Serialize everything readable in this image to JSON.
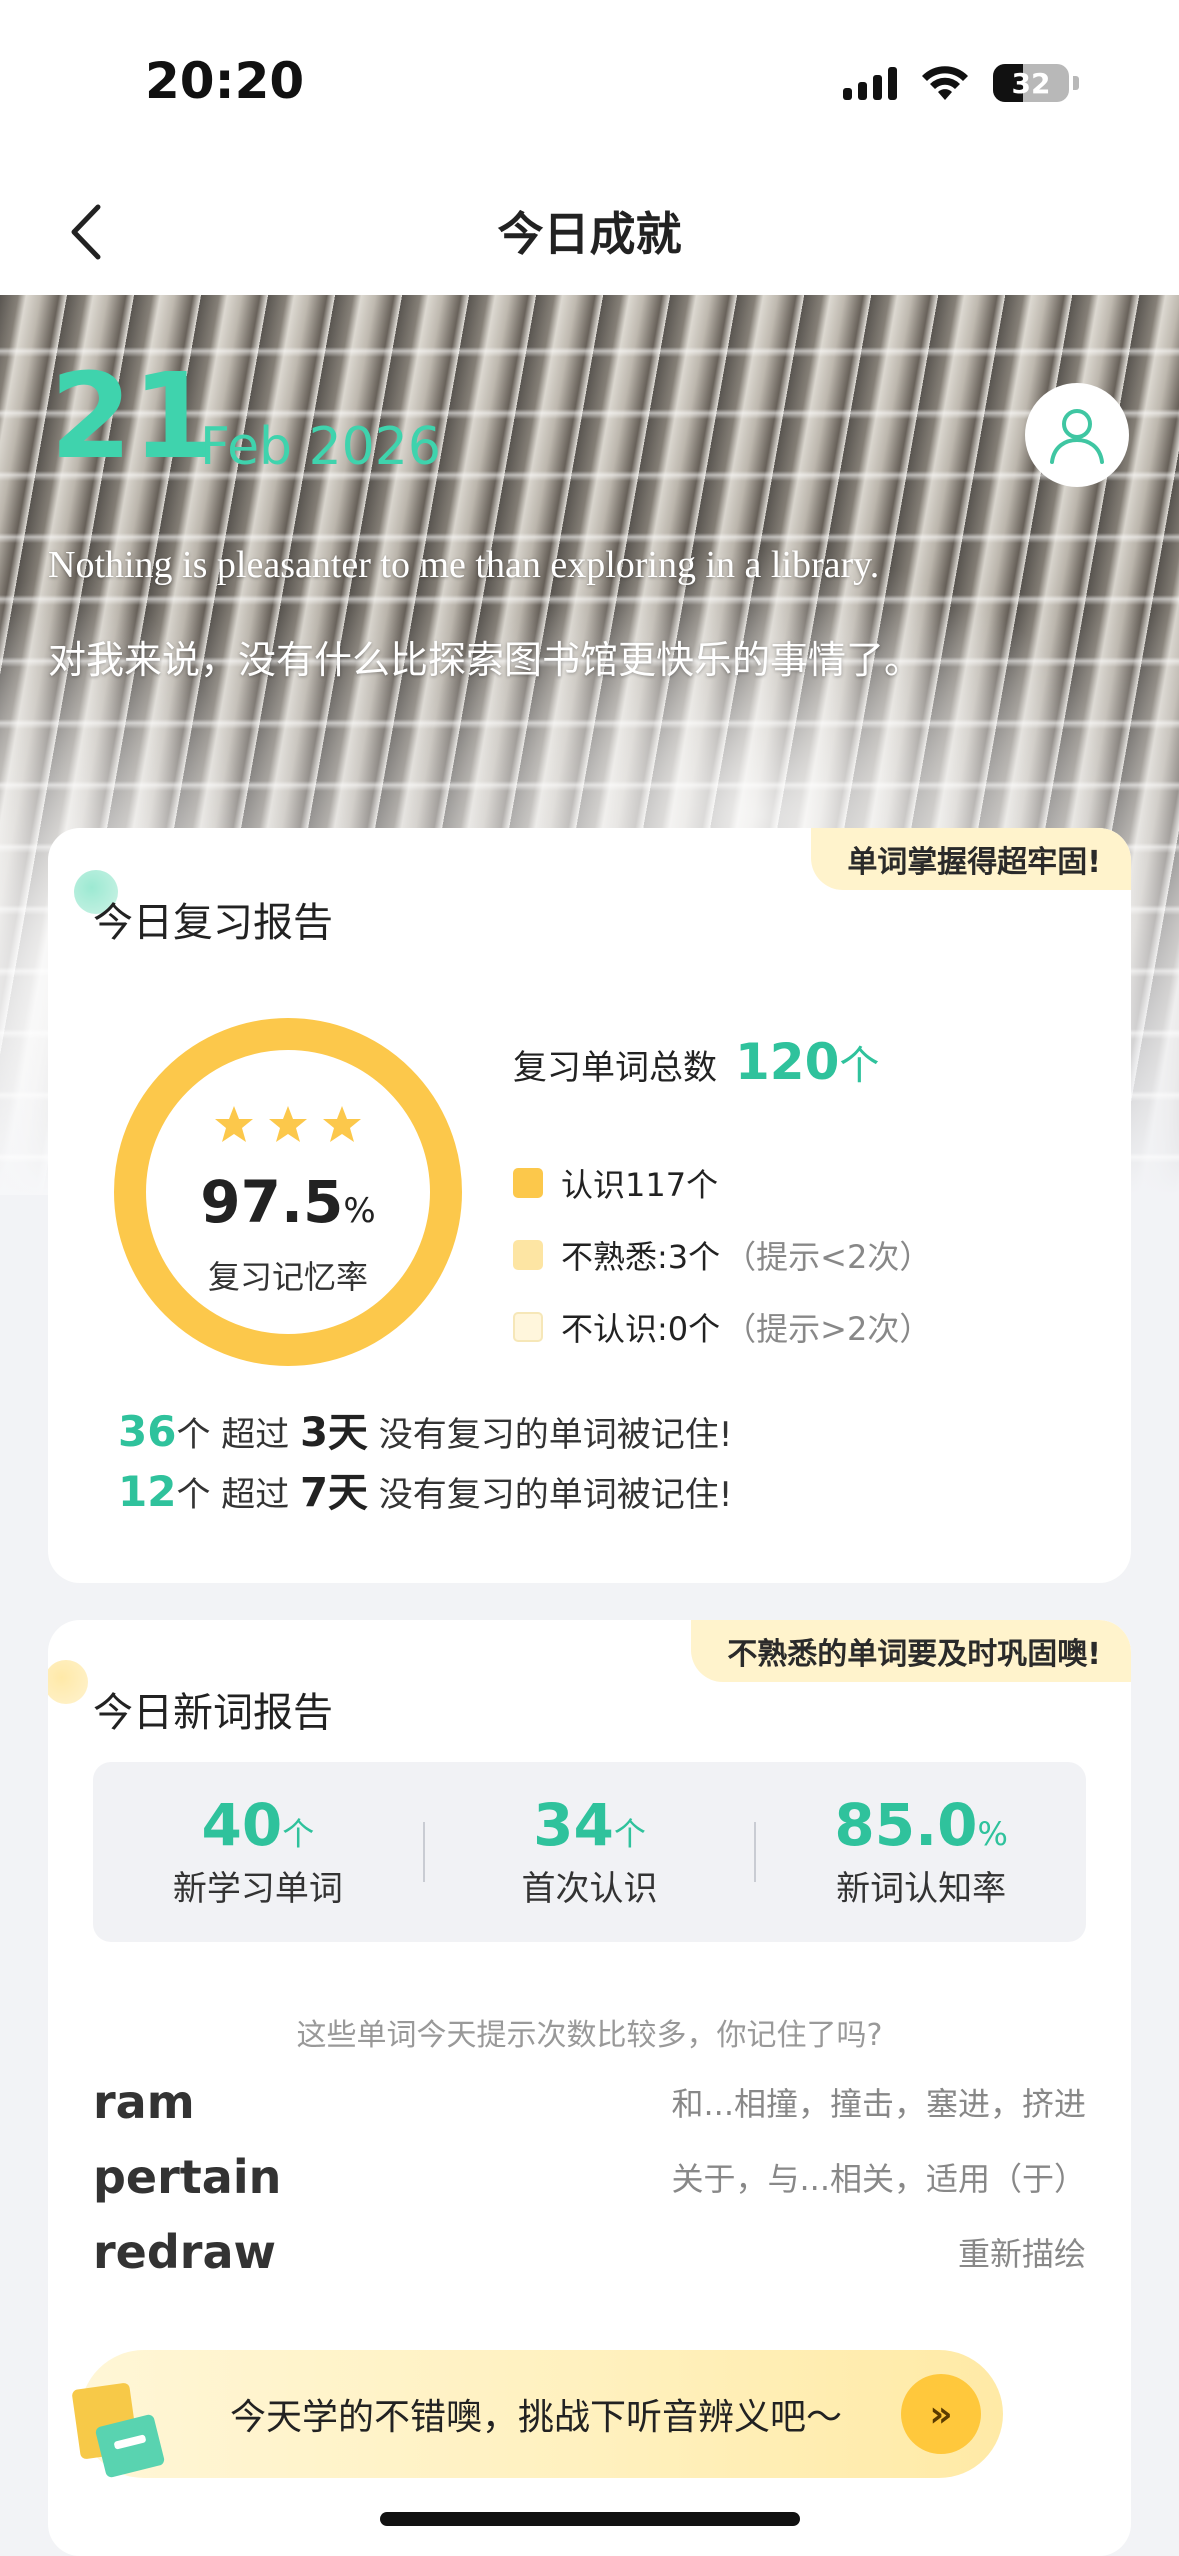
{
  "status_bar": {
    "time": "20:20",
    "battery": "32"
  },
  "nav": {
    "title": "今日成就",
    "back_icon": "chevron-left-icon"
  },
  "hero": {
    "day": "21",
    "month_year": "Feb 2026",
    "quote_en": "Nothing is pleasanter to me than exploring in a library.",
    "quote_zh": "对我来说，没有什么比探索图书馆更快乐的事情了。"
  },
  "review_report": {
    "tag": "单词掌握得超牢固!",
    "title": "今日复习报告",
    "rate_value": "97.5",
    "rate_unit": "%",
    "rate_label": "复习记忆率",
    "stars": 3,
    "total_label": "复习单词总数",
    "total_value": "120",
    "total_unit": "个",
    "legend": [
      {
        "label": "认识117个",
        "hint": "",
        "color": "#fcc84b"
      },
      {
        "label": "不熟悉:3个",
        "hint": "（提示<2次）",
        "color": "#fde5a3"
      },
      {
        "label": "不认识:0个",
        "hint": "（提示>2次）",
        "color": "#fff6dc"
      }
    ],
    "memo": [
      {
        "num": "36",
        "pre": "个 超过 ",
        "days": "3天",
        "post": " 没有复习的单词被记住!"
      },
      {
        "num": "12",
        "pre": "个 超过 ",
        "days": "7天",
        "post": " 没有复习的单词被记住!"
      }
    ]
  },
  "new_report": {
    "tag": "不熟悉的单词要及时巩固噢!",
    "title": "今日新词报告",
    "stats": [
      {
        "value": "40",
        "unit": "个",
        "label": "新学习单词"
      },
      {
        "value": "34",
        "unit": "个",
        "label": "首次认识"
      },
      {
        "value": "85.0",
        "unit": "%",
        "label": "新词认知率"
      }
    ],
    "hint": "这些单词今天提示次数比较多，你记住了吗?",
    "words": [
      {
        "word": "ram",
        "meaning": "和...相撞，撞击，塞进，挤进"
      },
      {
        "word": "pertain",
        "meaning": "关于，与...相关，适用（于）"
      },
      {
        "word": "redraw",
        "meaning": "重新描绘"
      }
    ],
    "challenge_text": "今天学的不错噢，挑战下听音辨义吧～",
    "challenge_btn": "»"
  },
  "colors": {
    "accent": "#2fc29c",
    "hero_accent": "#3fd3ad",
    "ring": "#fcc84b",
    "tag_bg": "#fff3cc"
  }
}
